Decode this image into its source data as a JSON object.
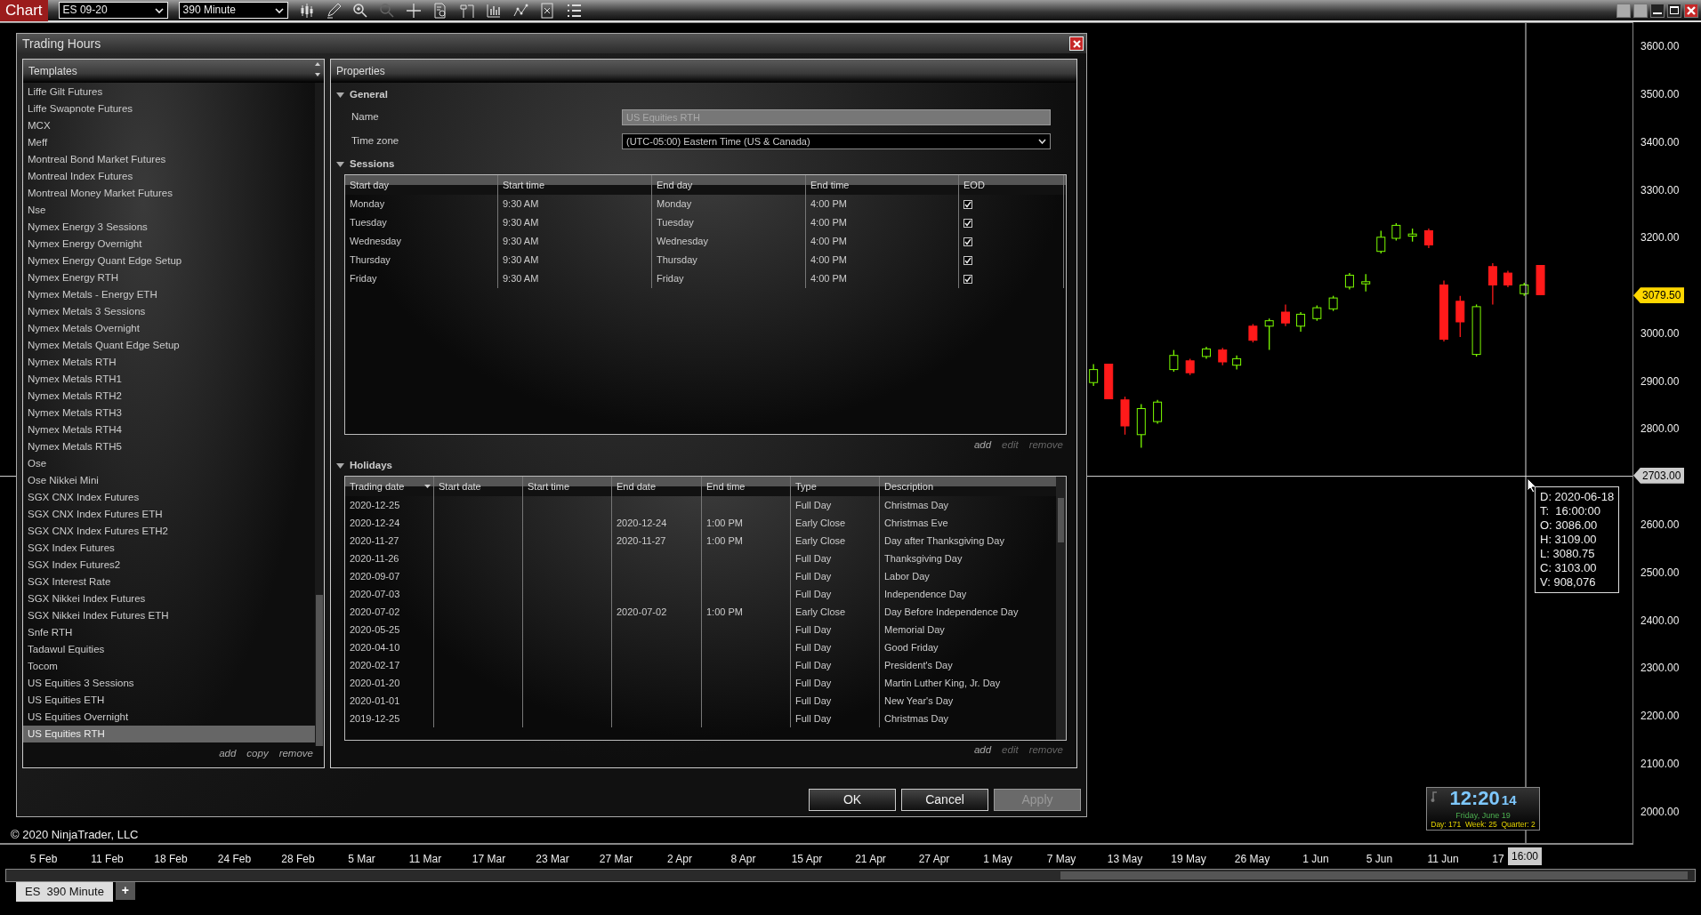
{
  "toolbar": {
    "title": "Chart",
    "instrument": "ES 09-20",
    "interval": "390 Minute"
  },
  "dialog": {
    "title": "Trading Hours",
    "templates": {
      "header": "Templates",
      "items": [
        {
          "label": "Liffe Gilt Futures",
          "selected": false
        },
        {
          "label": "Liffe Swapnote Futures",
          "selected": false
        },
        {
          "label": "MCX",
          "selected": false
        },
        {
          "label": "Meff",
          "selected": false
        },
        {
          "label": "Montreal Bond Market Futures",
          "selected": false
        },
        {
          "label": "Montreal Index Futures",
          "selected": false
        },
        {
          "label": "Montreal Money Market Futures",
          "selected": false
        },
        {
          "label": "Nse",
          "selected": false
        },
        {
          "label": "Nymex Energy 3 Sessions",
          "selected": false
        },
        {
          "label": "Nymex Energy Overnight",
          "selected": false
        },
        {
          "label": "Nymex Energy Quant Edge Setup",
          "selected": false
        },
        {
          "label": "Nymex Energy RTH",
          "selected": false
        },
        {
          "label": "Nymex Metals - Energy ETH",
          "selected": false
        },
        {
          "label": "Nymex Metals 3 Sessions",
          "selected": false
        },
        {
          "label": "Nymex Metals Overnight",
          "selected": false
        },
        {
          "label": "Nymex Metals Quant Edge Setup",
          "selected": false
        },
        {
          "label": "Nymex Metals RTH",
          "selected": false
        },
        {
          "label": "Nymex Metals RTH1",
          "selected": false
        },
        {
          "label": "Nymex Metals RTH2",
          "selected": false
        },
        {
          "label": "Nymex Metals RTH3",
          "selected": false
        },
        {
          "label": "Nymex Metals RTH4",
          "selected": false
        },
        {
          "label": "Nymex Metals RTH5",
          "selected": false
        },
        {
          "label": "Ose",
          "selected": false
        },
        {
          "label": "Ose Nikkei Mini",
          "selected": false
        },
        {
          "label": "SGX CNX Index Futures",
          "selected": false
        },
        {
          "label": "SGX CNX Index Futures ETH",
          "selected": false
        },
        {
          "label": "SGX CNX Index Futures ETH2",
          "selected": false
        },
        {
          "label": "SGX Index Futures",
          "selected": false
        },
        {
          "label": "SGX Index Futures2",
          "selected": false
        },
        {
          "label": "SGX Interest Rate",
          "selected": false
        },
        {
          "label": "SGX Nikkei Index Futures",
          "selected": false
        },
        {
          "label": "SGX Nikkei Index Futures ETH",
          "selected": false
        },
        {
          "label": "Snfe RTH",
          "selected": false
        },
        {
          "label": "Tadawul Equities",
          "selected": false
        },
        {
          "label": "Tocom",
          "selected": false
        },
        {
          "label": "US Equities 3 Sessions",
          "selected": false
        },
        {
          "label": "US Equities ETH",
          "selected": false
        },
        {
          "label": "US Equities Overnight",
          "selected": false
        },
        {
          "label": "US Equities RTH",
          "selected": true
        }
      ],
      "actions": [
        {
          "label": "add",
          "disabled": false
        },
        {
          "label": "copy",
          "disabled": false
        },
        {
          "label": "remove",
          "disabled": false
        }
      ]
    },
    "properties": {
      "header": "Properties",
      "general": {
        "label": "General",
        "expanded": true,
        "name": {
          "label": "Name",
          "value": "US Equities RTH",
          "disabled": true
        },
        "time_zone": {
          "label": "Time zone",
          "value": "(UTC-05:00) Eastern Time (US & Canada)"
        }
      },
      "sessions": {
        "label": "Sessions",
        "expanded": true,
        "columns": [
          "Start day",
          "Start time",
          "End day",
          "End time",
          "EOD"
        ],
        "rows": [
          {
            "start_day": "Monday",
            "start_time": "9:30 AM",
            "end_day": "Monday",
            "end_time": "4:00 PM",
            "eod": true
          },
          {
            "start_day": "Tuesday",
            "start_time": "9:30 AM",
            "end_day": "Tuesday",
            "end_time": "4:00 PM",
            "eod": true
          },
          {
            "start_day": "Wednesday",
            "start_time": "9:30 AM",
            "end_day": "Wednesday",
            "end_time": "4:00 PM",
            "eod": true
          },
          {
            "start_day": "Thursday",
            "start_time": "9:30 AM",
            "end_day": "Thursday",
            "end_time": "4:00 PM",
            "eod": true
          },
          {
            "start_day": "Friday",
            "start_time": "9:30 AM",
            "end_day": "Friday",
            "end_time": "4:00 PM",
            "eod": true
          }
        ],
        "actions": [
          {
            "label": "add",
            "disabled": false
          },
          {
            "label": "edit",
            "disabled": true
          },
          {
            "label": "remove",
            "disabled": true
          }
        ]
      },
      "holidays": {
        "label": "Holidays",
        "expanded": true,
        "columns": [
          "Trading date",
          "Start date",
          "Start time",
          "End date",
          "End time",
          "Type",
          "Description"
        ],
        "rows": [
          [
            "2020-12-25",
            "",
            "",
            "",
            "",
            "Full Day",
            "Christmas Day"
          ],
          [
            "2020-12-24",
            "",
            "",
            "2020-12-24",
            "1:00 PM",
            "Early Close",
            "Christmas Eve"
          ],
          [
            "2020-11-27",
            "",
            "",
            "2020-11-27",
            "1:00 PM",
            "Early Close",
            "Day after Thanksgiving Day"
          ],
          [
            "2020-11-26",
            "",
            "",
            "",
            "",
            "Full Day",
            "Thanksgiving Day"
          ],
          [
            "2020-09-07",
            "",
            "",
            "",
            "",
            "Full Day",
            "Labor Day"
          ],
          [
            "2020-07-03",
            "",
            "",
            "",
            "",
            "Full Day",
            "Independence Day"
          ],
          [
            "2020-07-02",
            "",
            "",
            "2020-07-02",
            "1:00 PM",
            "Early Close",
            "Day Before Independence Day"
          ],
          [
            "2020-05-25",
            "",
            "",
            "",
            "",
            "Full Day",
            "Memorial Day"
          ],
          [
            "2020-04-10",
            "",
            "",
            "",
            "",
            "Full Day",
            "Good Friday"
          ],
          [
            "2020-02-17",
            "",
            "",
            "",
            "",
            "Full Day",
            "President's Day"
          ],
          [
            "2020-01-20",
            "",
            "",
            "",
            "",
            "Full Day",
            "Martin Luther King, Jr. Day"
          ],
          [
            "2020-01-01",
            "",
            "",
            "",
            "",
            "Full Day",
            "New Year's Day"
          ],
          [
            "2019-12-25",
            "",
            "",
            "",
            "",
            "Full Day",
            "Christmas Day"
          ]
        ],
        "actions": [
          {
            "label": "add",
            "disabled": false
          },
          {
            "label": "edit",
            "disabled": true
          },
          {
            "label": "remove",
            "disabled": true
          }
        ]
      }
    },
    "buttons": [
      {
        "label": "OK",
        "disabled": false
      },
      {
        "label": "Cancel",
        "disabled": false
      },
      {
        "label": "Apply",
        "disabled": true
      }
    ]
  },
  "copyright": "© 2020 NinjaTrader, LLC",
  "chart": {
    "price_ticks": [
      "3600.00",
      "3500.00",
      "3400.00",
      "3300.00",
      "3200.00",
      "3000.00",
      "2900.00",
      "2800.00",
      "2600.00",
      "2500.00",
      "2400.00",
      "2300.00",
      "2200.00",
      "2100.00",
      "2000.00"
    ],
    "current_price": "3079.50",
    "crosshair_price": "2703.00",
    "date_labels": [
      "5 Feb",
      "11 Feb",
      "18 Feb",
      "24 Feb",
      "28 Feb",
      "5 Mar",
      "11 Mar",
      "17 Mar",
      "23 Mar",
      "27 Mar",
      "2 Apr",
      "8 Apr",
      "15 Apr",
      "21 Apr",
      "27 Apr",
      "1 May",
      "7 May",
      "13 May",
      "19 May",
      "26 May",
      "1 Jun",
      "5 Jun",
      "11 Jun",
      "17"
    ],
    "crosshair_time": "16:00",
    "tooltip": [
      "D: 2020-06-18",
      "T:  16:00:00",
      "O: 3086.00",
      "H: 3109.00",
      "L: 3080.75",
      "C: 3103.00",
      "V: 908,076"
    ],
    "clock": {
      "time": "12:20",
      "seconds": "14",
      "date": "Friday, June 19",
      "stats": "Day: 171  Week: 25  Quarter: 2"
    }
  },
  "tabs": [
    {
      "label": "ES  390 Minute",
      "selected": true
    }
  ],
  "add_tab": "+"
}
